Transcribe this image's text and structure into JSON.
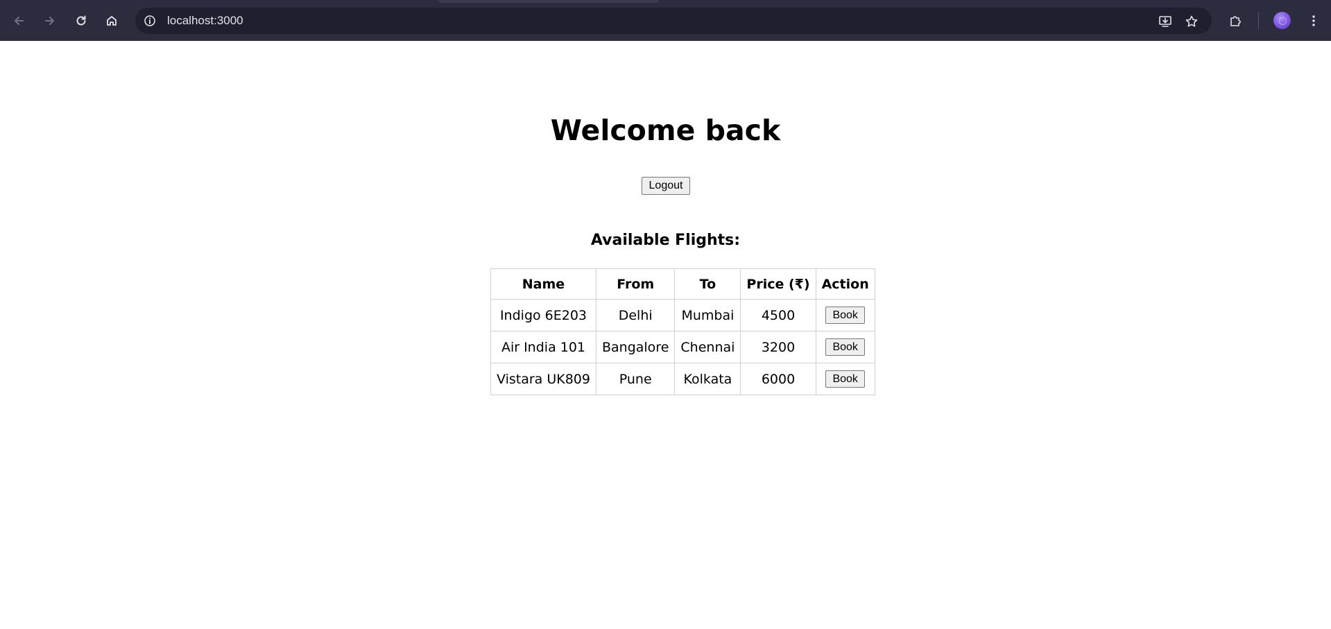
{
  "browser": {
    "url": "localhost:3000",
    "icons": [
      "back-icon",
      "forward-icon",
      "reload-icon",
      "home-icon",
      "site-info-icon",
      "install-app-icon",
      "bookmark-star-icon",
      "extensions-icon",
      "profile-avatar",
      "menu-kebab-icon"
    ]
  },
  "page": {
    "title": "Welcome back",
    "logout_label": "Logout",
    "section_heading": "Available Flights:"
  },
  "flights_table": {
    "headers": {
      "name": "Name",
      "from": "From",
      "to": "To",
      "price": "Price (₹)",
      "action": "Action"
    },
    "rows": [
      {
        "name": "Indigo 6E203",
        "from": "Delhi",
        "to": "Mumbai",
        "price": "4500",
        "action_label": "Book"
      },
      {
        "name": "Air India 101",
        "from": "Bangalore",
        "to": "Chennai",
        "price": "3200",
        "action_label": "Book"
      },
      {
        "name": "Vistara UK809",
        "from": "Pune",
        "to": "Kolkata",
        "price": "6000",
        "action_label": "Book"
      }
    ]
  },
  "colors": {
    "chrome_bg": "#2b2d3f",
    "omnibox_bg": "#1e2030",
    "page_bg": "#ffffff",
    "table_border": "#d0d0d0"
  }
}
